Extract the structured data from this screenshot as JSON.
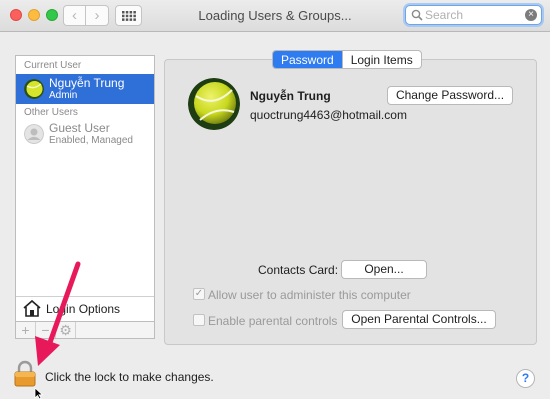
{
  "window": {
    "title": "Loading Users & Groups...",
    "search": {
      "placeholder": "Search",
      "value": ""
    }
  },
  "sidebar": {
    "current_user_label": "Current User",
    "current_user": {
      "name": "Nguyễn Trung",
      "role": "Admin",
      "selected": true
    },
    "other_users_label": "Other Users",
    "other_users": [
      {
        "name": "Guest User",
        "status": "Enabled, Managed"
      }
    ],
    "login_options_label": "Login Options",
    "tools": {
      "add_icon": "plus-icon",
      "remove_icon": "minus-icon",
      "action_icon": "gear-icon"
    }
  },
  "tabs": [
    {
      "label": "Password",
      "active": true
    },
    {
      "label": "Login Items",
      "active": false
    }
  ],
  "account": {
    "full_name": "Nguyễn Trung",
    "email": "quoctrung4463@hotmail.com",
    "change_password_label": "Change Password..."
  },
  "contacts": {
    "label": "Contacts Card:",
    "open_label": "Open..."
  },
  "options": {
    "allow_admin": {
      "label": "Allow user to administer this computer",
      "checked": true,
      "enabled": false
    },
    "parental": {
      "label": "Enable parental controls",
      "checked": false,
      "enabled": false
    },
    "open_parental_label": "Open Parental Controls..."
  },
  "footer": {
    "lock_text": "Click the lock to make changes.",
    "help_label": "?"
  },
  "colors": {
    "selection": "#2f6fd8",
    "tab_active": "#2f7bf0",
    "annotation_arrow": "#e8195a",
    "lock": "#e89a2c"
  }
}
